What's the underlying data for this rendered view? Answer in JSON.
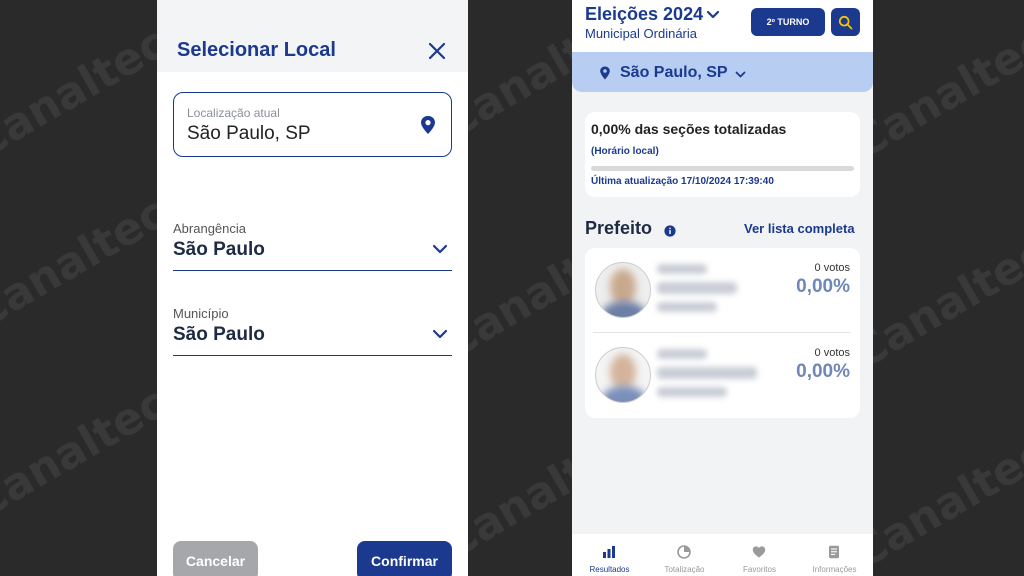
{
  "watermark": "Canaltech",
  "colors": {
    "primary": "#1b3a8f",
    "location_bar": "#b7cdf2",
    "cancel": "#a5a7ab"
  },
  "modal": {
    "title": "Selecionar Local",
    "close_icon": "close-icon",
    "location": {
      "label": "Localização atual",
      "value": "São Paulo, SP",
      "icon": "location-pin-icon"
    },
    "abrangencia": {
      "label": "Abrangência",
      "value": "São Paulo"
    },
    "municipio": {
      "label": "Município",
      "value": "São Paulo"
    },
    "cancel_label": "Cancelar",
    "confirm_label": "Confirmar"
  },
  "results": {
    "title": "Eleições 2024",
    "subtitle": "Municipal Ordinária",
    "turno_label": "2º TURNO",
    "location": "São Paulo, SP",
    "status": {
      "title": "0,00% das seções totalizadas",
      "note": "(Horário local)",
      "progress": 0,
      "updated": "Última atualização 17/10/2024 17:39:40"
    },
    "section_title": "Prefeito",
    "see_all": "Ver lista completa",
    "candidates": [
      {
        "votes": "0 votos",
        "percent": "0,00%"
      },
      {
        "votes": "0 votos",
        "percent": "0,00%"
      }
    ],
    "tabs": [
      {
        "label": "Resultados",
        "icon": "bar-chart-icon",
        "active": true
      },
      {
        "label": "Totalização",
        "icon": "pie-chart-icon",
        "active": false
      },
      {
        "label": "Favoritos",
        "icon": "heart-icon",
        "active": false
      },
      {
        "label": "Informações",
        "icon": "document-icon",
        "active": false
      }
    ]
  }
}
